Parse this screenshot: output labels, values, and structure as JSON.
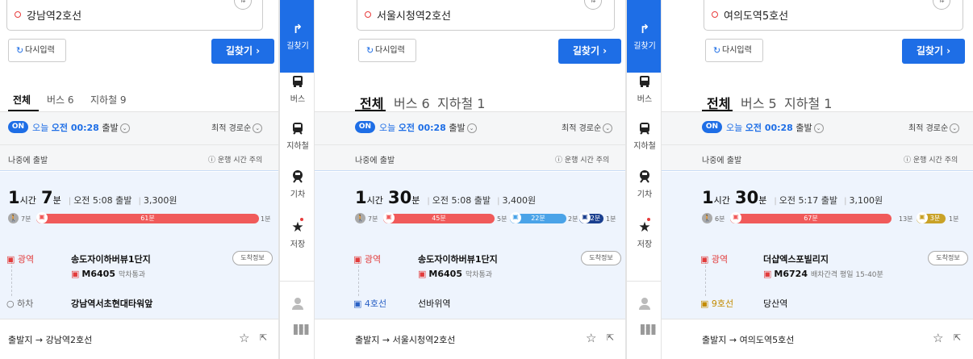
{
  "sidebar": {
    "directions_label": "길찾기",
    "bus_label": "버스",
    "subway_label": "지하철",
    "train_label": "기차",
    "saved_label": "저장"
  },
  "common": {
    "reset_label": "다시입력",
    "search_label": "길찾기 ›",
    "tab_all": "전체",
    "on_badge": "ON",
    "today": "오늘",
    "depart_time": "오전 00:28",
    "depart_suffix": "출발",
    "sort_label": "최적 경로순",
    "later_label": "나중에 출발",
    "notice_label": "ⓘ 운행 시간 주의",
    "arrival_info": "도착정보",
    "origin": "출발지",
    "arrow": "→",
    "hour_unit": "시간",
    "min_unit": "분",
    "colors": {
      "accent": "#1e6ee6",
      "bus_red": "#f05a5a",
      "line2": "#3cb44b",
      "line4": "#2b62c6",
      "line9": "#c9a227",
      "line5": "#8b3fc7"
    }
  },
  "panels": [
    {
      "destination": "강남역2호선",
      "tab_bus": "버스 6",
      "tab_subway": "지하철 9",
      "hours": "1",
      "minutes": "7",
      "depart": "오전 5:08 출발",
      "fare": "3,300원",
      "walk_start": "7분",
      "seg1": "61분",
      "walk_end": "1분",
      "step1_label": "광역",
      "step1_stop": "송도자이하버뷰1단지",
      "step1_bus": "M6405",
      "step1_bus_note": "막차통과",
      "step2_label": "하차",
      "step2_stop": "강남역서초현대타워앞"
    },
    {
      "destination": "서울시청역2호선",
      "tab_bus": "버스 6",
      "tab_subway": "지하철 1",
      "hours": "1",
      "minutes": "30",
      "depart": "오전 5:08 출발",
      "fare": "3,400원",
      "walk_start": "7분",
      "seg1": "45분",
      "mid1": "5분",
      "seg2": "22분",
      "mid2": "2분",
      "seg3": "2분",
      "walk_end": "1분",
      "step1_label": "광역",
      "step1_stop": "송도자이하버뷰1단지",
      "step1_bus": "M6405",
      "step1_bus_note": "막차통과",
      "step2_label": "4호선",
      "step2_stop": "선바위역"
    },
    {
      "destination": "여의도역5호선",
      "tab_bus": "버스 5",
      "tab_subway": "지하철 1",
      "hours": "1",
      "minutes": "30",
      "depart": "오전 5:17 출발",
      "fare": "3,100원",
      "walk_start": "6분",
      "seg1": "67분",
      "mid1": "13분",
      "seg2": "3분",
      "walk_end": "1분",
      "step1_label": "광역",
      "step1_stop": "더샵엑스포빌리지",
      "step1_bus": "M6724",
      "step1_bus_note": "배차간격 평일 15-40분",
      "step2_label": "9호선",
      "step2_stop": "당산역"
    }
  ]
}
